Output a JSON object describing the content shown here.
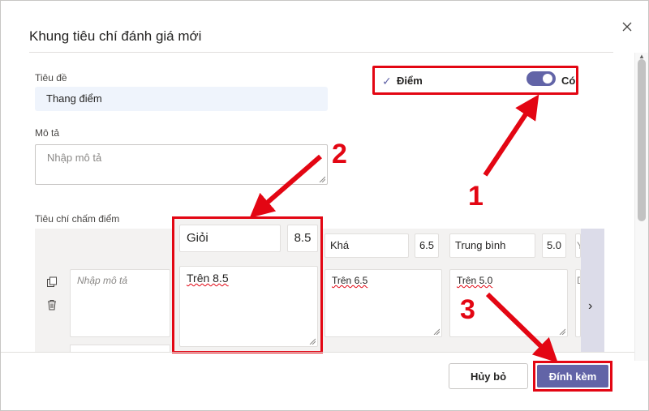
{
  "dialog": {
    "title": "Khung tiêu chí đánh giá mới",
    "close_icon": "close-icon"
  },
  "form": {
    "title_label": "Tiêu đề",
    "title_value": "Thang điểm",
    "desc_label": "Mô tả",
    "desc_placeholder": "Nhập mô tả",
    "points_label": "Điểm",
    "points_toggle_state": "Có",
    "points_enabled": true,
    "criteria_label": "Tiêu chí chấm điểm"
  },
  "levels": [
    {
      "name": "Giỏi",
      "score": "8.5",
      "description": "Trên 8.5"
    },
    {
      "name": "Khá",
      "score": "6.5",
      "description": "Trên 6.5"
    },
    {
      "name": "Trung bình",
      "score": "5.0",
      "description": "Trên 5.0"
    },
    {
      "name": "Yếu",
      "description": "Dưới"
    }
  ],
  "criterion": {
    "desc_placeholder": "Nhập mô tả"
  },
  "footer": {
    "cancel_label": "Hủy bỏ",
    "attach_label": "Đính kèm"
  },
  "annotations": [
    "1",
    "2",
    "3"
  ],
  "colors": {
    "accent": "#6264a7",
    "annotation_red": "#e30613",
    "title_input_bg": "#eff4fc",
    "grid_bg": "#f3f2f1"
  }
}
